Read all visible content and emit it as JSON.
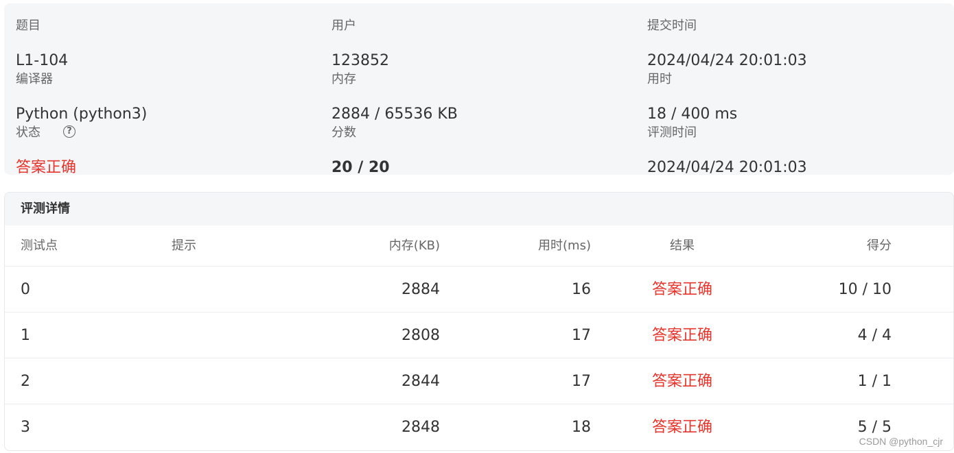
{
  "summary": {
    "problem_label": "题目",
    "problem_value": "L1-104",
    "user_label": "用户",
    "user_value": "123852",
    "submit_time_label": "提交时间",
    "submit_time_value": "2024/04/24 20:01:03",
    "compiler_label": "编译器",
    "compiler_value": "Python (python3)",
    "memory_label": "内存",
    "memory_value": "2884 / 65536 KB",
    "time_label": "用时",
    "time_value": "18 / 400 ms",
    "status_label": "状态",
    "status_help_icon": "question-circle-icon",
    "status_value": "答案正确",
    "score_label": "分数",
    "score_value": "20 / 20",
    "judge_time_label": "评测时间",
    "judge_time_value": "2024/04/24 20:01:03"
  },
  "details": {
    "title": "评测详情",
    "columns": {
      "case": "测试点",
      "hint": "提示",
      "memory": "内存(KB)",
      "time": "用时(ms)",
      "result": "结果",
      "score": "得分"
    },
    "rows": [
      {
        "case": "0",
        "hint": "",
        "memory": "2884",
        "time": "16",
        "result": "答案正确",
        "score": "10 / 10"
      },
      {
        "case": "1",
        "hint": "",
        "memory": "2808",
        "time": "17",
        "result": "答案正确",
        "score": "4 / 4"
      },
      {
        "case": "2",
        "hint": "",
        "memory": "2844",
        "time": "17",
        "result": "答案正确",
        "score": "1 / 1"
      },
      {
        "case": "3",
        "hint": "",
        "memory": "2848",
        "time": "18",
        "result": "答案正确",
        "score": "5 / 5"
      }
    ]
  },
  "watermark": "CSDN @python_cjr",
  "colors": {
    "accepted": "#e5352c",
    "card_background": "#f5f6f8"
  }
}
